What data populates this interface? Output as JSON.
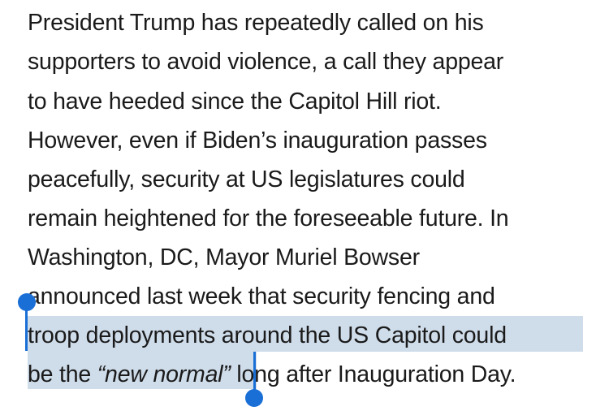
{
  "article": {
    "lines": [
      "President Trump has repeatedly called on his",
      "supporters to avoid violence, a call they appear",
      "to have heeded since the Capitol Hill riot.",
      "However, even if Biden’s inauguration passes",
      "peacefully, security at US legislatures could",
      "remain heightened for the foreseeable future. In",
      "Washington, DC, Mayor Muriel Bowser",
      "announced last week that security fencing and",
      "troop deployments around the US Capitol could"
    ],
    "last_line": {
      "before": "be the ",
      "quote": "“new normal”",
      "after": " long after Inauguration Day."
    }
  },
  "selection": {
    "color": "#cfdcea",
    "handle_color": "#1a6fd6"
  }
}
